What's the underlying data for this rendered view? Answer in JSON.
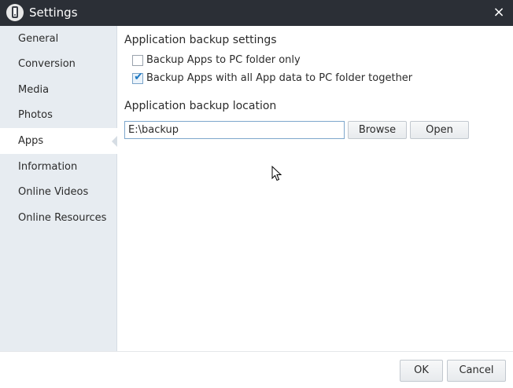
{
  "window": {
    "title": "Settings",
    "icon": "phone-app-icon",
    "close_glyph": "×"
  },
  "sidebar": {
    "items": [
      {
        "label": "General",
        "active": false
      },
      {
        "label": "Conversion",
        "active": false
      },
      {
        "label": "Media",
        "active": false
      },
      {
        "label": "Photos",
        "active": false
      },
      {
        "label": "Apps",
        "active": true
      },
      {
        "label": "Information",
        "active": false
      },
      {
        "label": "Online Videos",
        "active": false
      },
      {
        "label": "Online Resources",
        "active": false
      }
    ]
  },
  "main": {
    "backup_settings": {
      "title": "Application backup settings",
      "options": [
        {
          "label": "Backup Apps to PC folder only",
          "checked": false
        },
        {
          "label": "Backup Apps with all App data to PC folder together",
          "checked": true
        }
      ]
    },
    "backup_location": {
      "title": "Application backup location",
      "path_value": "E:\\backup",
      "browse_label": "Browse",
      "open_label": "Open"
    }
  },
  "footer": {
    "ok_label": "OK",
    "cancel_label": "Cancel"
  },
  "colors": {
    "titlebar": "#2b2f36",
    "sidebar_bg": "#e7ecf1",
    "accent": "#1f7ac4",
    "input_border": "#7ea7cc"
  }
}
